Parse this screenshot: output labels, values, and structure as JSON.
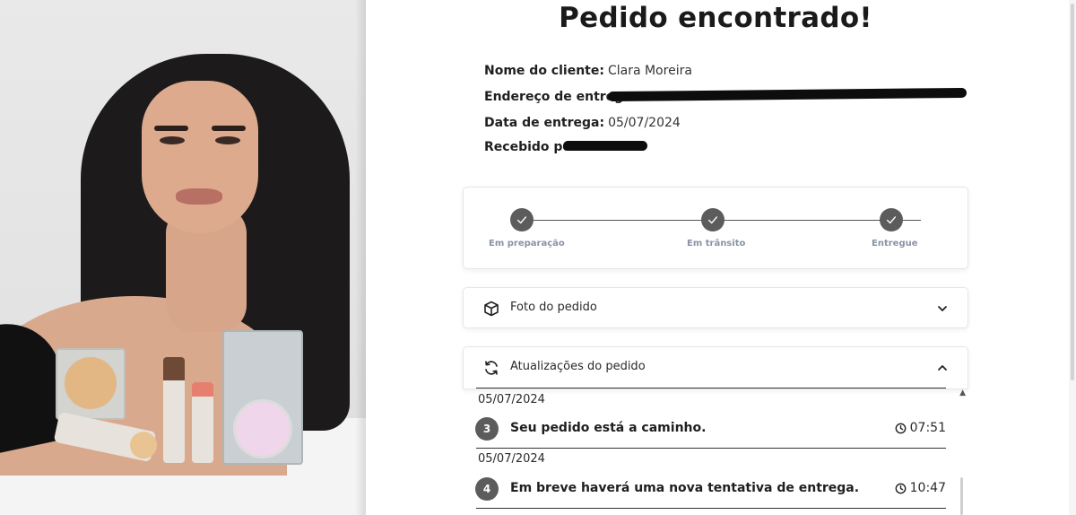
{
  "header": {
    "title": "Pedido encontrado!"
  },
  "details": {
    "client_label": "Nome do cliente:",
    "client_value": "Clara Moreira",
    "address_label": "Endereço de entrega:",
    "date_label": "Data de entrega:",
    "date_value": "05/07/2024",
    "received_label": "Recebido por:"
  },
  "progress": {
    "steps": [
      {
        "label": "Em preparação",
        "done": true
      },
      {
        "label": "Em trânsito",
        "done": true
      },
      {
        "label": "Entregue",
        "done": true
      }
    ]
  },
  "photo_section": {
    "title": "Foto do pedido",
    "icon": "package-icon",
    "expanded": false
  },
  "updates_section": {
    "title": "Atualizações do pedido",
    "icon": "refresh-icon",
    "expanded": true,
    "items": [
      {
        "date": "05/07/2024",
        "number": "3",
        "message": "Seu pedido está a caminho.",
        "time": "07:51"
      },
      {
        "date": "05/07/2024",
        "number": "4",
        "message": "Em breve haverá uma nova tentativa de entrega.",
        "time": "10:47"
      }
    ]
  },
  "colors": {
    "step_dot": "#5c5c5c",
    "step_label": "#8a93a5"
  }
}
